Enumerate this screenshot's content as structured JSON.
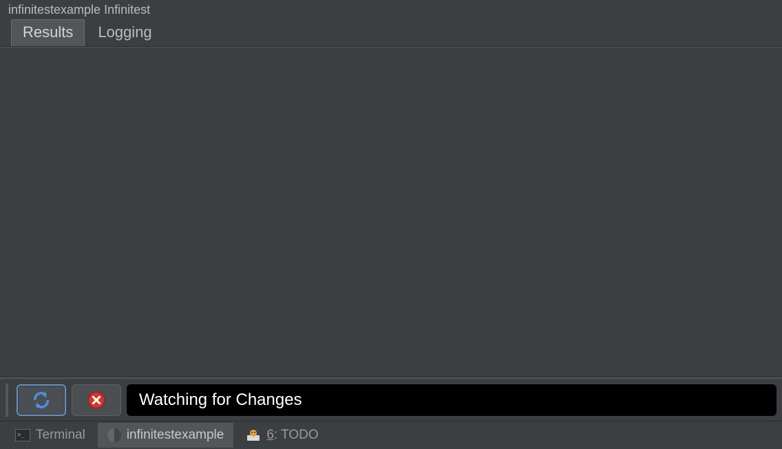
{
  "title": "infinitestexample Infinitest",
  "tabs": [
    {
      "label": "Results",
      "active": true
    },
    {
      "label": "Logging",
      "active": false
    }
  ],
  "status": {
    "text": "Watching for Changes"
  },
  "bottomTabs": {
    "terminal": "Terminal",
    "infinitest": "infinitestexample",
    "todo_prefix": "6",
    "todo_suffix": ": TODO"
  }
}
